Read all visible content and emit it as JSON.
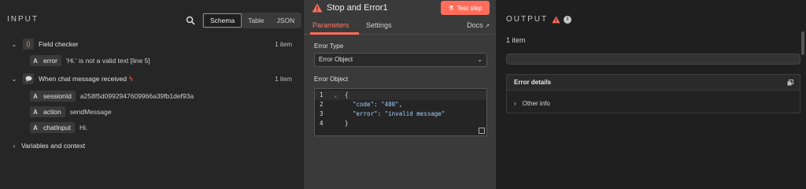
{
  "input": {
    "title": "INPUT",
    "views": [
      "Schema",
      "Table",
      "JSON"
    ],
    "nodes": [
      {
        "label": "Field checker",
        "icon": "{}",
        "count": "1 item",
        "fields": [
          {
            "type": "A",
            "name": "error",
            "value": "'Hi.' is not a valid text [line 5]"
          }
        ]
      },
      {
        "label": "When chat message received",
        "icon": "chat-bubble-icon",
        "count": "1 item",
        "fields": [
          {
            "type": "A",
            "name": "sessionId",
            "value": "a258f5d0992947609966a39fb1def93a"
          },
          {
            "type": "A",
            "name": "action",
            "value": "sendMessage"
          },
          {
            "type": "A",
            "name": "chatInput",
            "value": "Hi."
          }
        ]
      }
    ],
    "variables_label": "Variables and context"
  },
  "node": {
    "title": "Stop and Error1",
    "test_step": "Test step",
    "tabs": [
      "Parameters",
      "Settings"
    ],
    "docs": "Docs",
    "error_type_label": "Error Type",
    "error_type_value": "Error Object",
    "error_object_label": "Error Object",
    "code_lines": [
      "1",
      "2",
      "3",
      "4"
    ],
    "code": {
      "open": "{",
      "key1": "\"code\"",
      "val1": "\"400\"",
      "key2": "\"error\"",
      "val2": "\"invalid message\"",
      "close": "}"
    }
  },
  "output": {
    "title": "OUTPUT",
    "count": "1 item",
    "error_details": "Error details",
    "other_info": "Other info"
  },
  "colors": {
    "accent": "#ff6d5a",
    "json_string": "#9fd0ff"
  }
}
